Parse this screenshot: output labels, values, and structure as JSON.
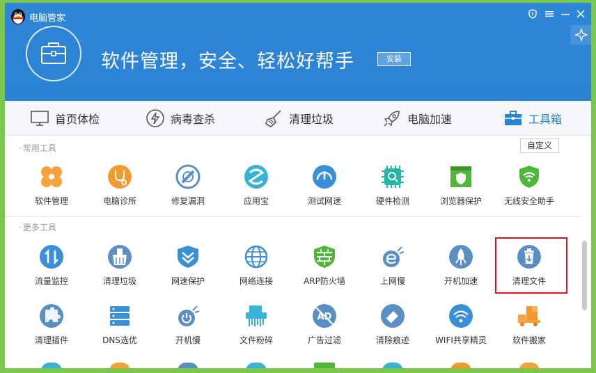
{
  "window": {
    "title": "电脑管家",
    "colors": {
      "primary": "#2b83d6",
      "frame": "#7cc84a",
      "highlight": "#e0141b"
    },
    "controls": [
      "shield-icon",
      "menu-icon",
      "minimize-icon",
      "close-icon"
    ]
  },
  "banner": {
    "headline": "软件管理，安全、轻松好帮手",
    "install_label": "安装"
  },
  "nav": {
    "items": [
      {
        "label": "首页体检",
        "icon": "monitor-icon"
      },
      {
        "label": "病毒查杀",
        "icon": "lightning-shield-icon"
      },
      {
        "label": "清理垃圾",
        "icon": "broom-icon"
      },
      {
        "label": "电脑加速",
        "icon": "rocket-icon"
      },
      {
        "label": "工具箱",
        "icon": "toolbox-icon",
        "active": true
      }
    ]
  },
  "common_tools": {
    "title": "常用工具",
    "customize_label": "自定义",
    "items": [
      {
        "label": "软件管理",
        "icon": "software-manager-icon"
      },
      {
        "label": "电脑诊所",
        "icon": "stethoscope-icon"
      },
      {
        "label": "修复漏洞",
        "icon": "patch-icon"
      },
      {
        "label": "应用宝",
        "icon": "app-store-icon"
      },
      {
        "label": "测试网速",
        "icon": "speed-test-icon"
      },
      {
        "label": "硬件检测",
        "icon": "hardware-check-icon"
      },
      {
        "label": "浏览器保护",
        "icon": "browser-shield-icon"
      },
      {
        "label": "无线安全助手",
        "icon": "wifi-shield-icon"
      }
    ]
  },
  "more_tools": {
    "title": "更多工具",
    "row1": [
      {
        "label": "流量监控",
        "icon": "traffic-monitor-icon"
      },
      {
        "label": "清理垃圾",
        "icon": "trash-cleaner-icon"
      },
      {
        "label": "网速保护",
        "icon": "speed-protect-icon"
      },
      {
        "label": "网络连接",
        "icon": "globe-icon"
      },
      {
        "label": "ARP防火墙",
        "icon": "firewall-icon"
      },
      {
        "label": "上网慢",
        "icon": "slow-browsing-icon"
      },
      {
        "label": "开机加速",
        "icon": "boot-speed-icon"
      },
      {
        "label": "清理文件",
        "icon": "file-shredder-trash-icon"
      }
    ],
    "row2": [
      {
        "label": "清理插件",
        "icon": "plugin-icon"
      },
      {
        "label": "DNS选优",
        "icon": "dns-icon"
      },
      {
        "label": "开机慢",
        "icon": "slow-boot-icon"
      },
      {
        "label": "文件粉碎",
        "icon": "shredder-icon"
      },
      {
        "label": "广告过滤",
        "icon": "ad-block-icon"
      },
      {
        "label": "清除痕迹",
        "icon": "eraser-icon"
      },
      {
        "label": "WIFI共享精灵",
        "icon": "wifi-share-icon"
      },
      {
        "label": "软件搬家",
        "icon": "moving-truck-icon"
      }
    ]
  }
}
